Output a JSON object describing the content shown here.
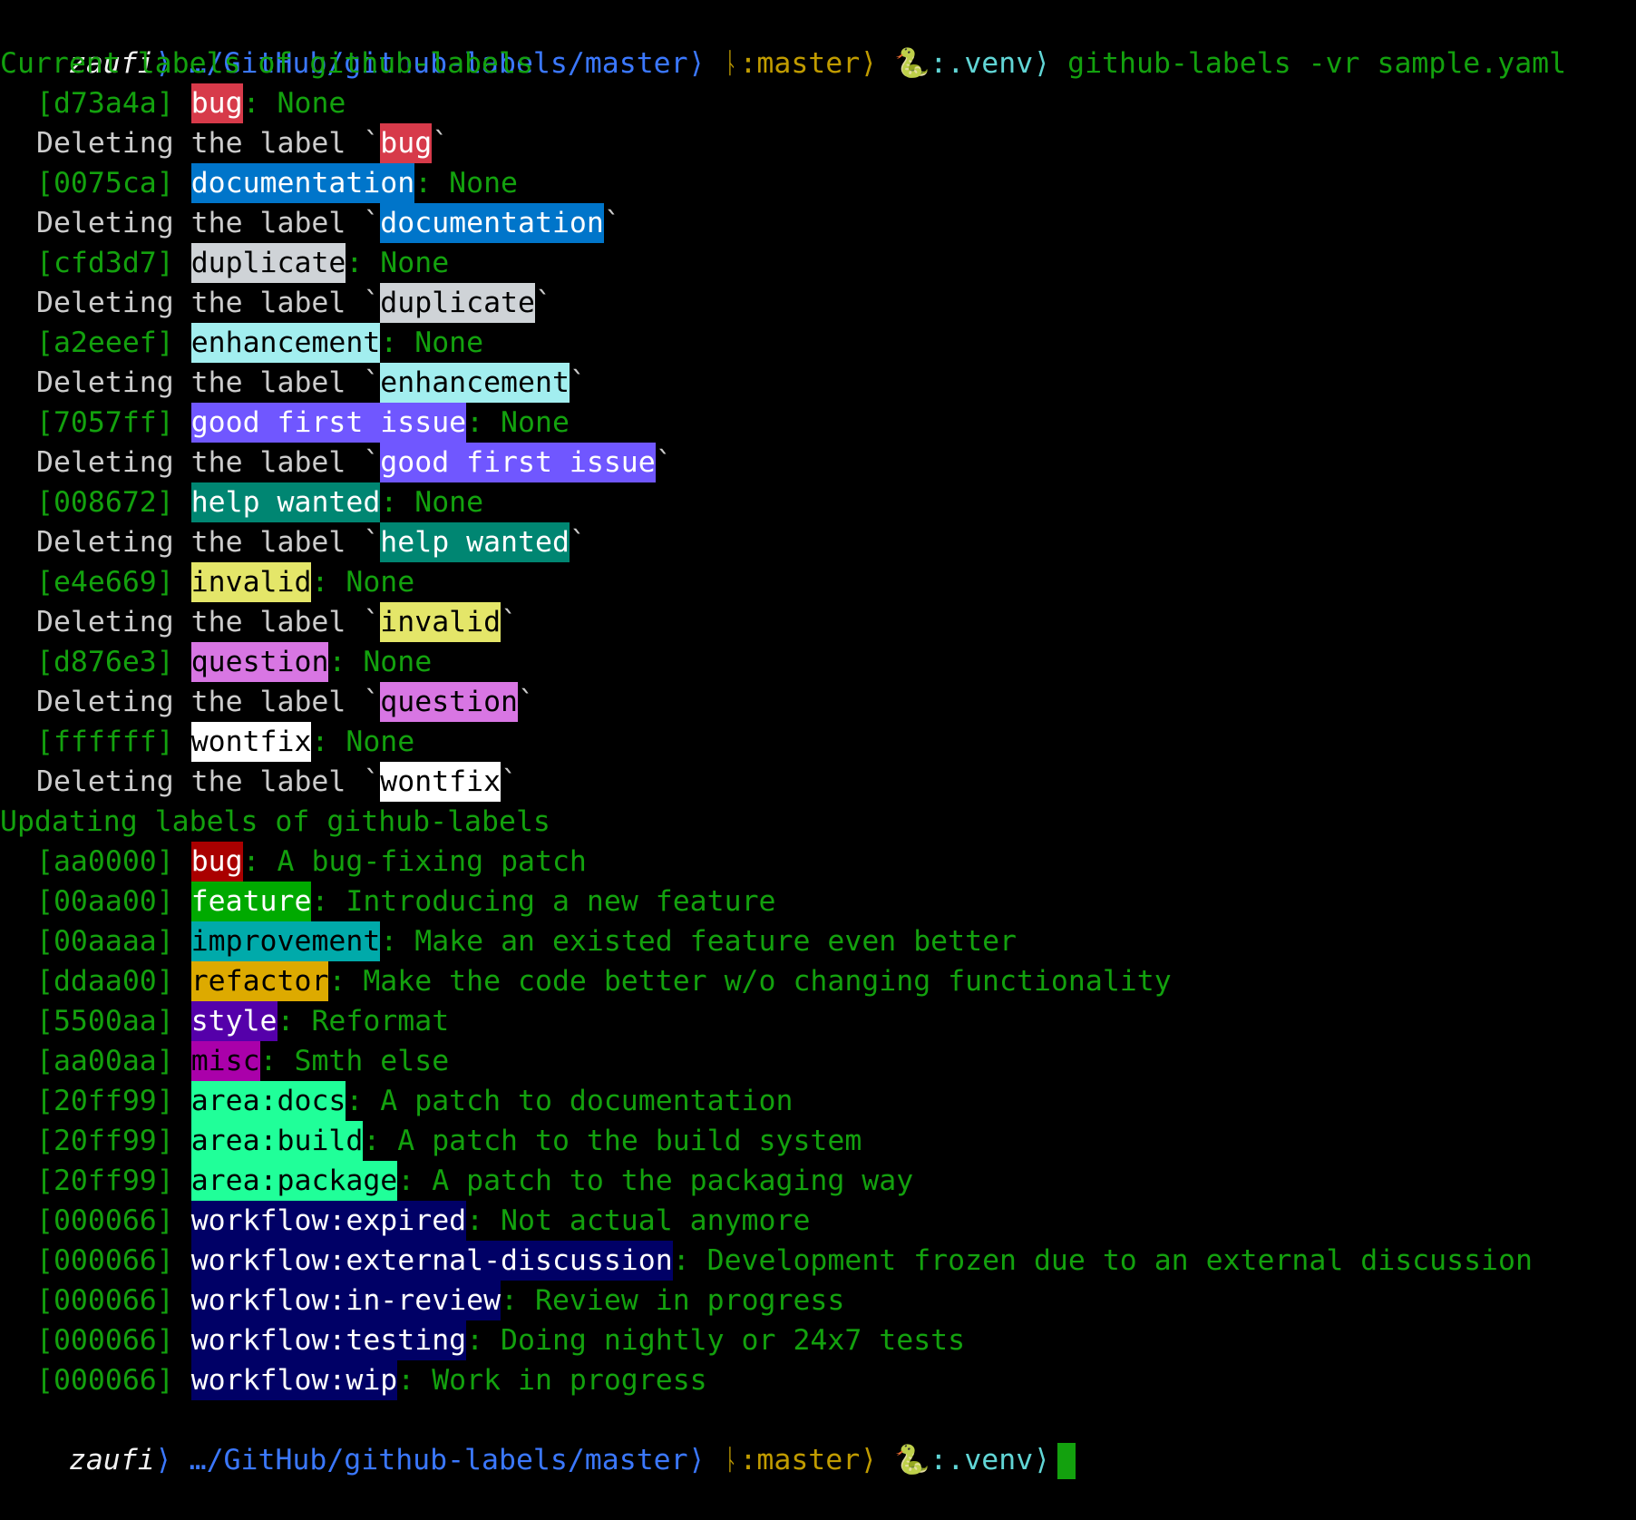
{
  "prompt": {
    "user": "zaufi",
    "sep": "⟩",
    "path": "…/GitHub/github-labels/master",
    "branch_icon": "git-branch-icon",
    "branch": ":master",
    "venv_icon": "python-snake-icon",
    "venv": ":.venv",
    "command": "github-labels -vr sample.yaml"
  },
  "current_header": "Current labels of github-labels",
  "deleting_prefix": "Deleting the label `",
  "backtick": "`",
  "current_labels": [
    {
      "hash": "[d73a4a]",
      "name": "bug",
      "bg": "#d73a4a",
      "fg": "#ffffff",
      "desc": ": None"
    },
    {
      "hash": "[0075ca]",
      "name": "documentation",
      "bg": "#0075ca",
      "fg": "#ffffff",
      "desc": ": None"
    },
    {
      "hash": "[cfd3d7]",
      "name": "duplicate",
      "bg": "#cfd3d7",
      "fg": "#000000",
      "desc": ": None"
    },
    {
      "hash": "[a2eeef]",
      "name": "enhancement",
      "bg": "#a2eeef",
      "fg": "#000000",
      "desc": ": None"
    },
    {
      "hash": "[7057ff]",
      "name": "good first issue",
      "bg": "#7057ff",
      "fg": "#ffffff",
      "desc": ": None"
    },
    {
      "hash": "[008672]",
      "name": "help wanted",
      "bg": "#008672",
      "fg": "#ffffff",
      "desc": ": None"
    },
    {
      "hash": "[e4e669]",
      "name": "invalid",
      "bg": "#e4e669",
      "fg": "#000000",
      "desc": ": None"
    },
    {
      "hash": "[d876e3]",
      "name": "question",
      "bg": "#d876e3",
      "fg": "#000000",
      "desc": ": None"
    },
    {
      "hash": "[ffffff]",
      "name": "wontfix",
      "bg": "#ffffff",
      "fg": "#000000",
      "desc": ": None"
    }
  ],
  "updating_header": "Updating labels of github-labels",
  "new_labels": [
    {
      "hash": "[aa0000]",
      "name": "bug",
      "bg": "#aa0000",
      "fg": "#ffffff",
      "desc": ": A bug-fixing patch"
    },
    {
      "hash": "[00aa00]",
      "name": "feature",
      "bg": "#00aa00",
      "fg": "#ffffff",
      "desc": ": Introducing a new feature"
    },
    {
      "hash": "[00aaaa]",
      "name": "improvement",
      "bg": "#00aaaa",
      "fg": "#000000",
      "desc": ": Make an existed feature even better"
    },
    {
      "hash": "[ddaa00]",
      "name": "refactor",
      "bg": "#ddaa00",
      "fg": "#000000",
      "desc": ": Make the code better w/o changing functionality"
    },
    {
      "hash": "[5500aa]",
      "name": "style",
      "bg": "#5500aa",
      "fg": "#ffffff",
      "desc": ": Reformat"
    },
    {
      "hash": "[aa00aa]",
      "name": "misc",
      "bg": "#aa00aa",
      "fg": "#000000",
      "desc": ": Smth else"
    },
    {
      "hash": "[20ff99]",
      "name": "area:docs",
      "bg": "#20ff99",
      "fg": "#000000",
      "desc": ": A patch to documentation"
    },
    {
      "hash": "[20ff99]",
      "name": "area:build",
      "bg": "#20ff99",
      "fg": "#000000",
      "desc": ": A patch to the build system"
    },
    {
      "hash": "[20ff99]",
      "name": "area:package",
      "bg": "#20ff99",
      "fg": "#000000",
      "desc": ": A patch to the packaging way"
    },
    {
      "hash": "[000066]",
      "name": "workflow:expired",
      "bg": "#000066",
      "fg": "#ffffff",
      "desc": ": Not actual anymore"
    },
    {
      "hash": "[000066]",
      "name": "workflow:external-discussion",
      "bg": "#000066",
      "fg": "#ffffff",
      "desc": ": Development frozen due to an external discussion"
    },
    {
      "hash": "[000066]",
      "name": "workflow:in-review",
      "bg": "#000066",
      "fg": "#ffffff",
      "desc": ": Review in progress"
    },
    {
      "hash": "[000066]",
      "name": "workflow:testing",
      "bg": "#000066",
      "fg": "#ffffff",
      "desc": ": Doing nightly or 24x7 tests"
    },
    {
      "hash": "[000066]",
      "name": "workflow:wip",
      "bg": "#000066",
      "fg": "#ffffff",
      "desc": ": Work in progress"
    }
  ],
  "colors": {
    "background": "#000000",
    "text_green": "#13a10e",
    "gray": "#a8a8a8",
    "path_blue": "#3b78ff",
    "branch_orange": "#c19c00",
    "venv_cyan": "#61d6d6"
  }
}
